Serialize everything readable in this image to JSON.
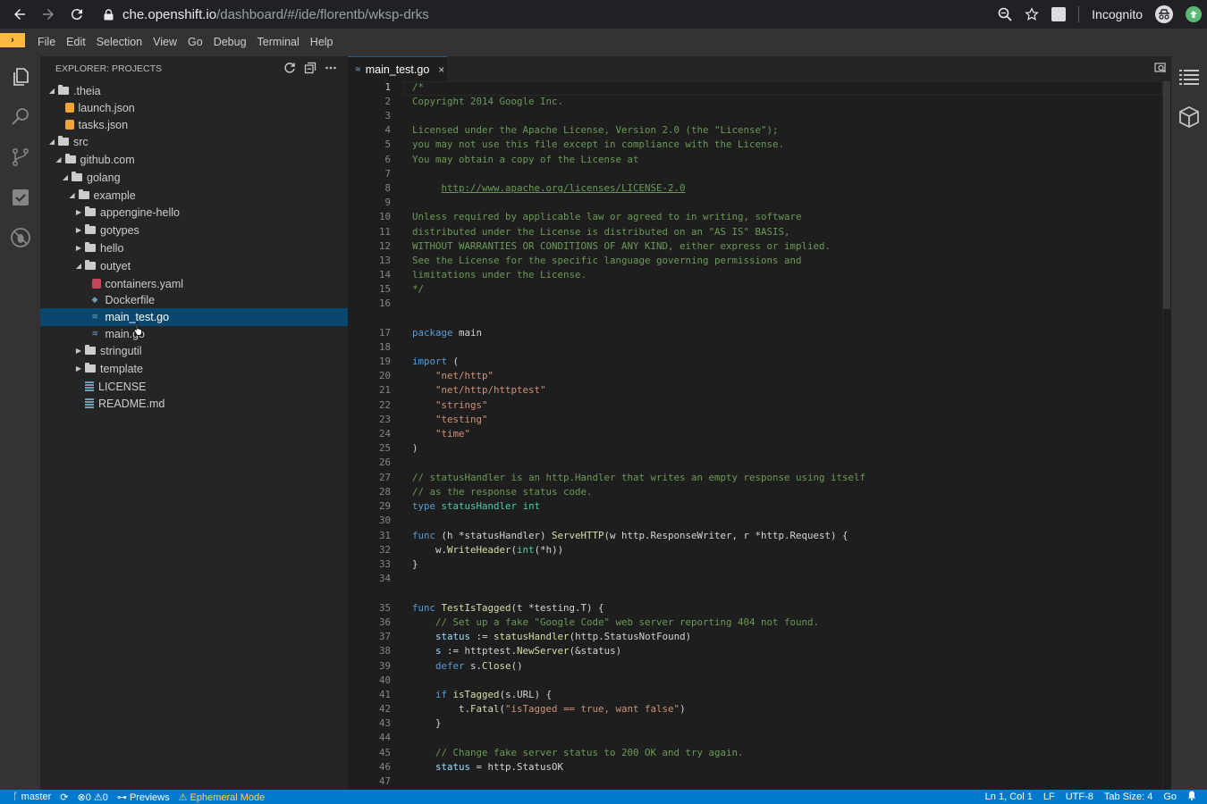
{
  "browser": {
    "url_host": "che.openshift.io",
    "url_path": "/dashboard/#/ide/florentb/wksp-drks",
    "incognito_label": "Incognito"
  },
  "menu": {
    "items": [
      "File",
      "Edit",
      "Selection",
      "View",
      "Go",
      "Debug",
      "Terminal",
      "Help"
    ]
  },
  "explorer": {
    "title": "EXPLORER: PROJECTS",
    "tree": [
      {
        "label": ".theia",
        "type": "folder",
        "depth": 0,
        "expanded": true
      },
      {
        "label": "launch.json",
        "type": "json",
        "depth": 1
      },
      {
        "label": "tasks.json",
        "type": "json",
        "depth": 1
      },
      {
        "label": "src",
        "type": "folder",
        "depth": 0,
        "expanded": true
      },
      {
        "label": "github.com",
        "type": "folder",
        "depth": 1,
        "expanded": true
      },
      {
        "label": "golang",
        "type": "folder",
        "depth": 2,
        "expanded": true
      },
      {
        "label": "example",
        "type": "folder",
        "depth": 3,
        "expanded": true
      },
      {
        "label": "appengine-hello",
        "type": "folder",
        "depth": 4,
        "expanded": false
      },
      {
        "label": "gotypes",
        "type": "folder",
        "depth": 4,
        "expanded": false
      },
      {
        "label": "hello",
        "type": "folder",
        "depth": 4,
        "expanded": false
      },
      {
        "label": "outyet",
        "type": "folder",
        "depth": 4,
        "expanded": true
      },
      {
        "label": "containers.yaml",
        "type": "yaml",
        "depth": 5
      },
      {
        "label": "Dockerfile",
        "type": "docker",
        "depth": 5
      },
      {
        "label": "main_test.go",
        "type": "go",
        "depth": 5,
        "selected": true
      },
      {
        "label": "main.go",
        "type": "go",
        "depth": 5
      },
      {
        "label": "stringutil",
        "type": "folder",
        "depth": 4,
        "expanded": false
      },
      {
        "label": "template",
        "type": "folder",
        "depth": 4,
        "expanded": false
      },
      {
        "label": "LICENSE",
        "type": "text",
        "depth": 4
      },
      {
        "label": "README.md",
        "type": "text",
        "depth": 4
      }
    ]
  },
  "editor": {
    "tab_label": "main_test.go",
    "tab_close": "×",
    "cursor_line": 1,
    "lines": [
      [
        [
          "/*",
          "comment"
        ]
      ],
      [
        [
          "Copyright 2014 Google Inc.",
          "comment"
        ]
      ],
      [],
      [
        [
          "Licensed under the Apache License, Version 2.0 (the \"License\");",
          "comment"
        ]
      ],
      [
        [
          "you may not use this file except in compliance with the License.",
          "comment"
        ]
      ],
      [
        [
          "You may obtain a copy of the License at",
          "comment"
        ]
      ],
      [],
      [
        [
          "     ",
          "comment"
        ],
        [
          "http://www.apache.org/licenses/LICENSE-2.0",
          "comment link"
        ]
      ],
      [],
      [
        [
          "Unless required by applicable law or agreed to in writing, software",
          "comment"
        ]
      ],
      [
        [
          "distributed under the License is distributed on an \"AS IS\" BASIS,",
          "comment"
        ]
      ],
      [
        [
          "WITHOUT WARRANTIES OR CONDITIONS OF ANY KIND, either express or implied.",
          "comment"
        ]
      ],
      [
        [
          "See the License for the specific language governing permissions and",
          "comment"
        ]
      ],
      [
        [
          "limitations under the License.",
          "comment"
        ]
      ],
      [
        [
          "*/",
          "comment"
        ]
      ],
      [],
      [
        [
          "package",
          "kw"
        ],
        [
          " main",
          ""
        ]
      ],
      [],
      [
        [
          "import",
          "kw"
        ],
        [
          " (",
          ""
        ]
      ],
      [
        [
          "    ",
          ""
        ],
        [
          "\"net/http\"",
          "str"
        ]
      ],
      [
        [
          "    ",
          ""
        ],
        [
          "\"net/http/httptest\"",
          "str"
        ]
      ],
      [
        [
          "    ",
          ""
        ],
        [
          "\"strings\"",
          "str"
        ]
      ],
      [
        [
          "    ",
          ""
        ],
        [
          "\"testing\"",
          "str"
        ]
      ],
      [
        [
          "    ",
          ""
        ],
        [
          "\"time\"",
          "str"
        ]
      ],
      [
        [
          ")",
          ""
        ]
      ],
      [],
      [
        [
          "// statusHandler is an http.Handler that writes an empty response using itself",
          "comment"
        ]
      ],
      [
        [
          "// as the response status code.",
          "comment"
        ]
      ],
      [
        [
          "type",
          "kw"
        ],
        [
          " ",
          ""
        ],
        [
          "statusHandler",
          "type"
        ],
        [
          " ",
          ""
        ],
        [
          "int",
          "type"
        ]
      ],
      [],
      [
        [
          "func",
          "kw"
        ],
        [
          " (h *statusHandler) ",
          ""
        ],
        [
          "ServeHTTP",
          "fn"
        ],
        [
          "(w http.ResponseWriter, r *http.Request) {",
          ""
        ]
      ],
      [
        [
          "    w.",
          ""
        ],
        [
          "WriteHeader",
          "fn"
        ],
        [
          "(",
          ""
        ],
        [
          "int",
          "type"
        ],
        [
          "(*h))",
          ""
        ]
      ],
      [
        [
          "}",
          ""
        ]
      ],
      [],
      [
        [
          "func",
          "kw"
        ],
        [
          " ",
          ""
        ],
        [
          "TestIsTagged",
          "fn"
        ],
        [
          "(t *testing.T) {",
          ""
        ]
      ],
      [
        [
          "    ",
          ""
        ],
        [
          "// Set up a fake \"Google Code\" web server reporting 404 not found.",
          "comment"
        ]
      ],
      [
        [
          "    ",
          ""
        ],
        [
          "status",
          "var"
        ],
        [
          " := ",
          ""
        ],
        [
          "statusHandler",
          "fn"
        ],
        [
          "(http.StatusNotFound)",
          ""
        ]
      ],
      [
        [
          "    ",
          ""
        ],
        [
          "s",
          "var"
        ],
        [
          " := httptest.",
          ""
        ],
        [
          "NewServer",
          "fn"
        ],
        [
          "(&status)",
          ""
        ]
      ],
      [
        [
          "    ",
          ""
        ],
        [
          "defer",
          "kw"
        ],
        [
          " s.",
          ""
        ],
        [
          "Close",
          "fn"
        ],
        [
          "()",
          ""
        ]
      ],
      [],
      [
        [
          "    ",
          ""
        ],
        [
          "if",
          "kw"
        ],
        [
          " ",
          ""
        ],
        [
          "isTagged",
          "fn"
        ],
        [
          "(s.URL) {",
          ""
        ]
      ],
      [
        [
          "        t.",
          ""
        ],
        [
          "Fatal",
          "fn"
        ],
        [
          "(",
          ""
        ],
        [
          "\"isTagged == true, want false\"",
          "str"
        ],
        [
          ")",
          ""
        ]
      ],
      [
        [
          "    }",
          ""
        ]
      ],
      [],
      [
        [
          "    ",
          ""
        ],
        [
          "// Change fake server status to 200 OK and try again.",
          "comment"
        ]
      ],
      [
        [
          "    ",
          ""
        ],
        [
          "status",
          "var"
        ],
        [
          " = http.StatusOK",
          ""
        ]
      ],
      []
    ]
  },
  "status_bar": {
    "branch": "master",
    "errors": "0",
    "warnings": "0",
    "previews": "Previews",
    "ephemeral": "Ephemeral Mode",
    "position": "Ln 1, Col 1",
    "eol": "LF",
    "encoding": "UTF-8",
    "tab_size": "Tab Size: 4",
    "language": "Go"
  }
}
